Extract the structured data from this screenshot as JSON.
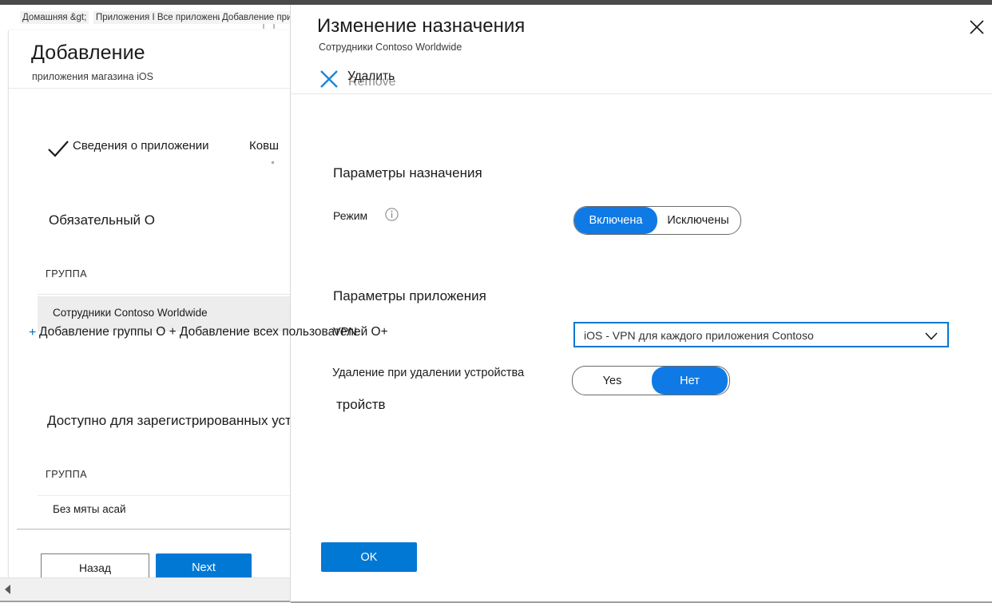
{
  "background_page": {
    "breadcrumb": {
      "items": [
        "Домашняя &gt;",
        "Приложения I Все приложения &gt;",
        "Добавление приложения"
      ]
    },
    "title": "Добавление",
    "subtitle": "приложения магазина iOS",
    "steps": {
      "check_icon": "check-icon",
      "step1": "Сведения о приложении",
      "step2": "Ковш"
    },
    "section_required": "Обязательный О",
    "group_header_1": "ГРУППА",
    "group_row_1": "Сотрудники Contoso Worldwide",
    "add_links_plus": "+",
    "add_links_text": "Добавление группы О + Добавление всех пользователей О+",
    "section_available": "Доступно для зарегистрированных устройств",
    "group_header_2": "ГРУППА",
    "group_row_2": "Без мяты асай",
    "back_button": "Назад",
    "next_button": "Next"
  },
  "dialog": {
    "title": "Изменение назначения",
    "subtitle": "Сотрудники Contoso Worldwide",
    "remove_command": "Удалить",
    "remove_ghost": "Remove",
    "close_icon": "close-icon",
    "section_assignment": "Параметры назначения",
    "mode": {
      "label": "Режим",
      "info_icon": "info-icon",
      "options": [
        "Включена",
        "Исключены"
      ],
      "selected": "Включена"
    },
    "section_app": "Параметры приложения",
    "vpn": {
      "label": "VPN",
      "value": "iOS - VPN для каждого приложения Contoso",
      "chevron_icon": "chevron-down-icon"
    },
    "uninstall": {
      "label": "Удаление при удалении устройства",
      "options": [
        "Yes",
        "Нет"
      ],
      "selected": "Нет"
    },
    "ok_button": "OK"
  },
  "colors": {
    "accent": "#0078d4",
    "toggle_blue": "#0f7ae5",
    "link_blue": "#0f6cbd",
    "top_strip": "#4a4a4a"
  }
}
